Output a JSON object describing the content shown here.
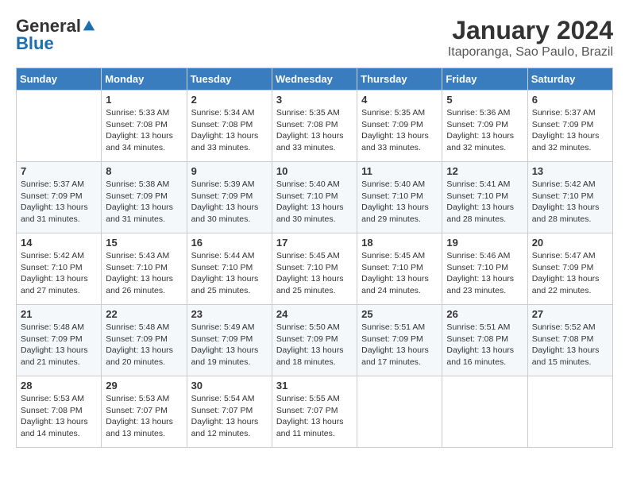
{
  "logo": {
    "general": "General",
    "blue": "Blue"
  },
  "title": "January 2024",
  "subtitle": "Itaporanga, Sao Paulo, Brazil",
  "header_days": [
    "Sunday",
    "Monday",
    "Tuesday",
    "Wednesday",
    "Thursday",
    "Friday",
    "Saturday"
  ],
  "weeks": [
    [
      {
        "day": "",
        "sunrise": "",
        "sunset": "",
        "daylight": ""
      },
      {
        "day": "1",
        "sunrise": "Sunrise: 5:33 AM",
        "sunset": "Sunset: 7:08 PM",
        "daylight": "Daylight: 13 hours and 34 minutes."
      },
      {
        "day": "2",
        "sunrise": "Sunrise: 5:34 AM",
        "sunset": "Sunset: 7:08 PM",
        "daylight": "Daylight: 13 hours and 33 minutes."
      },
      {
        "day": "3",
        "sunrise": "Sunrise: 5:35 AM",
        "sunset": "Sunset: 7:08 PM",
        "daylight": "Daylight: 13 hours and 33 minutes."
      },
      {
        "day": "4",
        "sunrise": "Sunrise: 5:35 AM",
        "sunset": "Sunset: 7:09 PM",
        "daylight": "Daylight: 13 hours and 33 minutes."
      },
      {
        "day": "5",
        "sunrise": "Sunrise: 5:36 AM",
        "sunset": "Sunset: 7:09 PM",
        "daylight": "Daylight: 13 hours and 32 minutes."
      },
      {
        "day": "6",
        "sunrise": "Sunrise: 5:37 AM",
        "sunset": "Sunset: 7:09 PM",
        "daylight": "Daylight: 13 hours and 32 minutes."
      }
    ],
    [
      {
        "day": "7",
        "sunrise": "Sunrise: 5:37 AM",
        "sunset": "Sunset: 7:09 PM",
        "daylight": "Daylight: 13 hours and 31 minutes."
      },
      {
        "day": "8",
        "sunrise": "Sunrise: 5:38 AM",
        "sunset": "Sunset: 7:09 PM",
        "daylight": "Daylight: 13 hours and 31 minutes."
      },
      {
        "day": "9",
        "sunrise": "Sunrise: 5:39 AM",
        "sunset": "Sunset: 7:09 PM",
        "daylight": "Daylight: 13 hours and 30 minutes."
      },
      {
        "day": "10",
        "sunrise": "Sunrise: 5:40 AM",
        "sunset": "Sunset: 7:10 PM",
        "daylight": "Daylight: 13 hours and 30 minutes."
      },
      {
        "day": "11",
        "sunrise": "Sunrise: 5:40 AM",
        "sunset": "Sunset: 7:10 PM",
        "daylight": "Daylight: 13 hours and 29 minutes."
      },
      {
        "day": "12",
        "sunrise": "Sunrise: 5:41 AM",
        "sunset": "Sunset: 7:10 PM",
        "daylight": "Daylight: 13 hours and 28 minutes."
      },
      {
        "day": "13",
        "sunrise": "Sunrise: 5:42 AM",
        "sunset": "Sunset: 7:10 PM",
        "daylight": "Daylight: 13 hours and 28 minutes."
      }
    ],
    [
      {
        "day": "14",
        "sunrise": "Sunrise: 5:42 AM",
        "sunset": "Sunset: 7:10 PM",
        "daylight": "Daylight: 13 hours and 27 minutes."
      },
      {
        "day": "15",
        "sunrise": "Sunrise: 5:43 AM",
        "sunset": "Sunset: 7:10 PM",
        "daylight": "Daylight: 13 hours and 26 minutes."
      },
      {
        "day": "16",
        "sunrise": "Sunrise: 5:44 AM",
        "sunset": "Sunset: 7:10 PM",
        "daylight": "Daylight: 13 hours and 25 minutes."
      },
      {
        "day": "17",
        "sunrise": "Sunrise: 5:45 AM",
        "sunset": "Sunset: 7:10 PM",
        "daylight": "Daylight: 13 hours and 25 minutes."
      },
      {
        "day": "18",
        "sunrise": "Sunrise: 5:45 AM",
        "sunset": "Sunset: 7:10 PM",
        "daylight": "Daylight: 13 hours and 24 minutes."
      },
      {
        "day": "19",
        "sunrise": "Sunrise: 5:46 AM",
        "sunset": "Sunset: 7:10 PM",
        "daylight": "Daylight: 13 hours and 23 minutes."
      },
      {
        "day": "20",
        "sunrise": "Sunrise: 5:47 AM",
        "sunset": "Sunset: 7:09 PM",
        "daylight": "Daylight: 13 hours and 22 minutes."
      }
    ],
    [
      {
        "day": "21",
        "sunrise": "Sunrise: 5:48 AM",
        "sunset": "Sunset: 7:09 PM",
        "daylight": "Daylight: 13 hours and 21 minutes."
      },
      {
        "day": "22",
        "sunrise": "Sunrise: 5:48 AM",
        "sunset": "Sunset: 7:09 PM",
        "daylight": "Daylight: 13 hours and 20 minutes."
      },
      {
        "day": "23",
        "sunrise": "Sunrise: 5:49 AM",
        "sunset": "Sunset: 7:09 PM",
        "daylight": "Daylight: 13 hours and 19 minutes."
      },
      {
        "day": "24",
        "sunrise": "Sunrise: 5:50 AM",
        "sunset": "Sunset: 7:09 PM",
        "daylight": "Daylight: 13 hours and 18 minutes."
      },
      {
        "day": "25",
        "sunrise": "Sunrise: 5:51 AM",
        "sunset": "Sunset: 7:09 PM",
        "daylight": "Daylight: 13 hours and 17 minutes."
      },
      {
        "day": "26",
        "sunrise": "Sunrise: 5:51 AM",
        "sunset": "Sunset: 7:08 PM",
        "daylight": "Daylight: 13 hours and 16 minutes."
      },
      {
        "day": "27",
        "sunrise": "Sunrise: 5:52 AM",
        "sunset": "Sunset: 7:08 PM",
        "daylight": "Daylight: 13 hours and 15 minutes."
      }
    ],
    [
      {
        "day": "28",
        "sunrise": "Sunrise: 5:53 AM",
        "sunset": "Sunset: 7:08 PM",
        "daylight": "Daylight: 13 hours and 14 minutes."
      },
      {
        "day": "29",
        "sunrise": "Sunrise: 5:53 AM",
        "sunset": "Sunset: 7:07 PM",
        "daylight": "Daylight: 13 hours and 13 minutes."
      },
      {
        "day": "30",
        "sunrise": "Sunrise: 5:54 AM",
        "sunset": "Sunset: 7:07 PM",
        "daylight": "Daylight: 13 hours and 12 minutes."
      },
      {
        "day": "31",
        "sunrise": "Sunrise: 5:55 AM",
        "sunset": "Sunset: 7:07 PM",
        "daylight": "Daylight: 13 hours and 11 minutes."
      },
      {
        "day": "",
        "sunrise": "",
        "sunset": "",
        "daylight": ""
      },
      {
        "day": "",
        "sunrise": "",
        "sunset": "",
        "daylight": ""
      },
      {
        "day": "",
        "sunrise": "",
        "sunset": "",
        "daylight": ""
      }
    ]
  ]
}
